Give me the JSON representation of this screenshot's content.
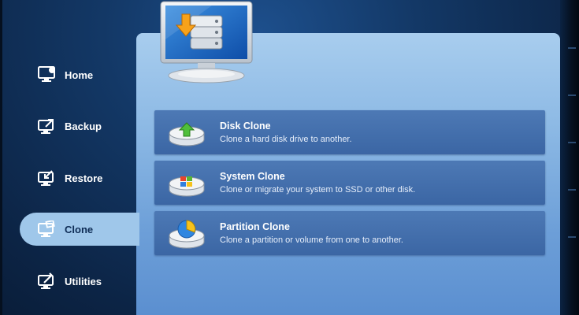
{
  "sidebar": {
    "items": [
      {
        "label": "Home",
        "icon": "home-monitor-icon"
      },
      {
        "label": "Backup",
        "icon": "backup-monitor-icon"
      },
      {
        "label": "Restore",
        "icon": "restore-monitor-icon"
      },
      {
        "label": "Clone",
        "icon": "clone-monitor-icon",
        "active": true
      },
      {
        "label": "Utilities",
        "icon": "utilities-monitor-icon"
      }
    ]
  },
  "main": {
    "header_icon": "monitor-with-drives-icon",
    "options": [
      {
        "title": "Disk Clone",
        "description": "Clone a hard disk drive to another.",
        "icon": "disk-clone-icon"
      },
      {
        "title": "System Clone",
        "description": "Clone or migrate your system to SSD or other disk.",
        "icon": "system-clone-icon"
      },
      {
        "title": "Partition Clone",
        "description": "Clone a partition or volume from one to another.",
        "icon": "partition-clone-icon"
      }
    ]
  },
  "colors": {
    "background": "#133866",
    "panel_top": "#a8cdee",
    "panel_bottom": "#5b8fd0",
    "active_tab": "#9fc7ea",
    "row": "#4470ad"
  }
}
